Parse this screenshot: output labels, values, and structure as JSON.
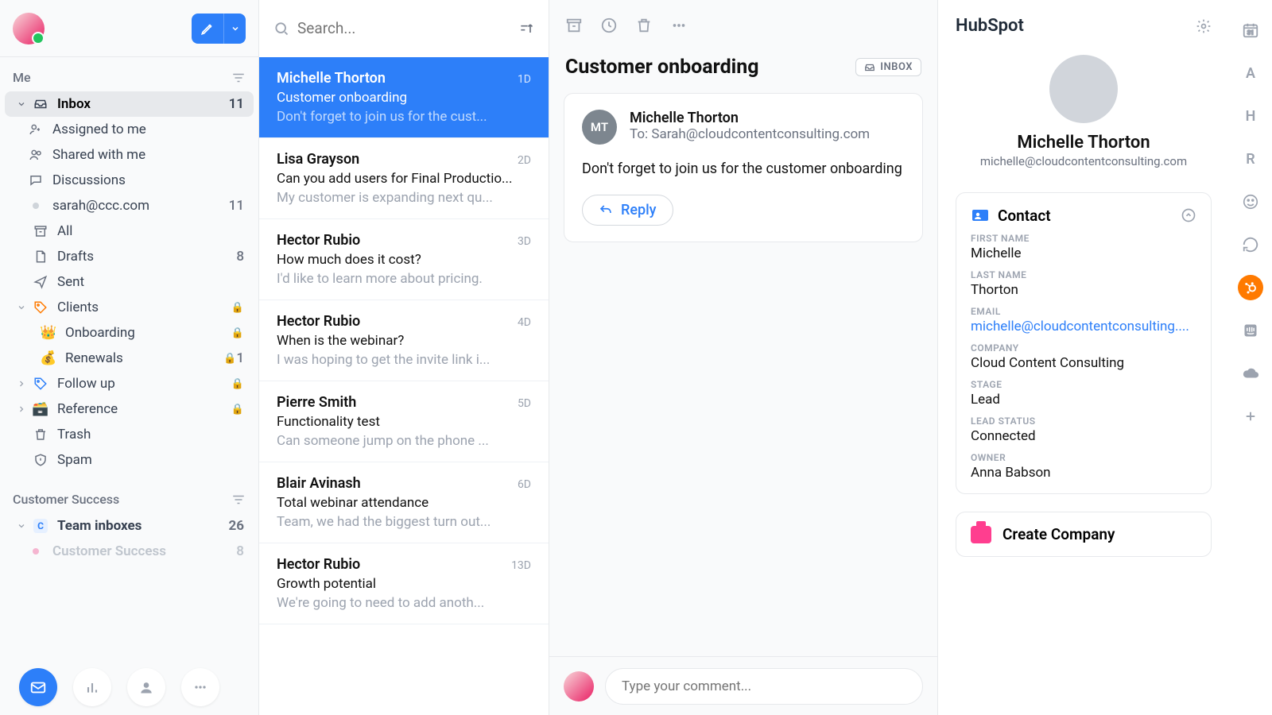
{
  "sidebar": {
    "sections": {
      "me": {
        "title": "Me"
      },
      "cs": {
        "title": "Customer Success"
      }
    },
    "inbox": {
      "label": "Inbox",
      "count": "11"
    },
    "assigned": {
      "label": "Assigned to me"
    },
    "shared": {
      "label": "Shared with me"
    },
    "discussions": {
      "label": "Discussions"
    },
    "account": {
      "label": "sarah@ccc.com",
      "count": "11"
    },
    "all": {
      "label": "All"
    },
    "drafts": {
      "label": "Drafts",
      "count": "8"
    },
    "sent": {
      "label": "Sent"
    },
    "clients": {
      "label": "Clients"
    },
    "onboarding": {
      "label": "Onboarding"
    },
    "renewals": {
      "label": "Renewals",
      "count": "1"
    },
    "followup": {
      "label": "Follow up"
    },
    "reference": {
      "label": "Reference"
    },
    "trash": {
      "label": "Trash"
    },
    "spam": {
      "label": "Spam"
    },
    "team_inboxes": {
      "label": "Team inboxes",
      "count": "26"
    },
    "customer_success": {
      "label": "Customer Success",
      "count": "8"
    }
  },
  "search": {
    "placeholder": "Search..."
  },
  "threads": [
    {
      "sender": "Michelle Thorton",
      "time": "1D",
      "subject": "Customer onboarding",
      "preview": "Don't forget to join us for the cust..."
    },
    {
      "sender": "Lisa Grayson",
      "time": "2D",
      "subject": "Can you add users for Final Productio...",
      "preview": "My customer is expanding next qu..."
    },
    {
      "sender": "Hector Rubio",
      "time": "3D",
      "subject": "How much does it cost?",
      "preview": "I'd like to learn more about pricing."
    },
    {
      "sender": "Hector Rubio",
      "time": "4D",
      "subject": "When is the webinar?",
      "preview": "I was hoping to get the invite link i..."
    },
    {
      "sender": "Pierre Smith",
      "time": "5D",
      "subject": "Functionality test",
      "preview": "Can someone jump on the phone ..."
    },
    {
      "sender": "Blair Avinash",
      "time": "6D",
      "subject": "Total webinar attendance",
      "preview": "Team, we had the biggest turn out..."
    },
    {
      "sender": "Hector Rubio",
      "time": "13D",
      "subject": "Growth potential",
      "preview": "We're going to need to add anoth..."
    }
  ],
  "reader": {
    "title": "Customer onboarding",
    "chip": "INBOX",
    "from_initials": "MT",
    "from": "Michelle Thorton",
    "to_prefix": "To: ",
    "to": "Sarah@cloudcontentconsulting.com",
    "body": "Don't forget to join us for the customer onboarding",
    "reply": "Reply",
    "comment_placeholder": "Type your comment..."
  },
  "hubspot": {
    "title": "HubSpot",
    "name": "Michelle Thorton",
    "email": "michelle@cloudcontentconsulting.com",
    "contact_card_title": "Contact",
    "fields": {
      "first_name_label": "FIRST NAME",
      "first_name": "Michelle",
      "last_name_label": "LAST NAME",
      "last_name": "Thorton",
      "email_label": "EMAIL",
      "email_value": "michelle@cloudcontentconsulting....",
      "company_label": "COMPANY",
      "company": "Cloud Content Consulting",
      "stage_label": "STAGE",
      "stage": "Lead",
      "lead_status_label": "LEAD STATUS",
      "lead_status": "Connected",
      "owner_label": "OWNER",
      "owner": "Anna Babson"
    },
    "create_company": "Create Company"
  },
  "rail": {
    "a": "A",
    "h": "H",
    "r": "R"
  }
}
